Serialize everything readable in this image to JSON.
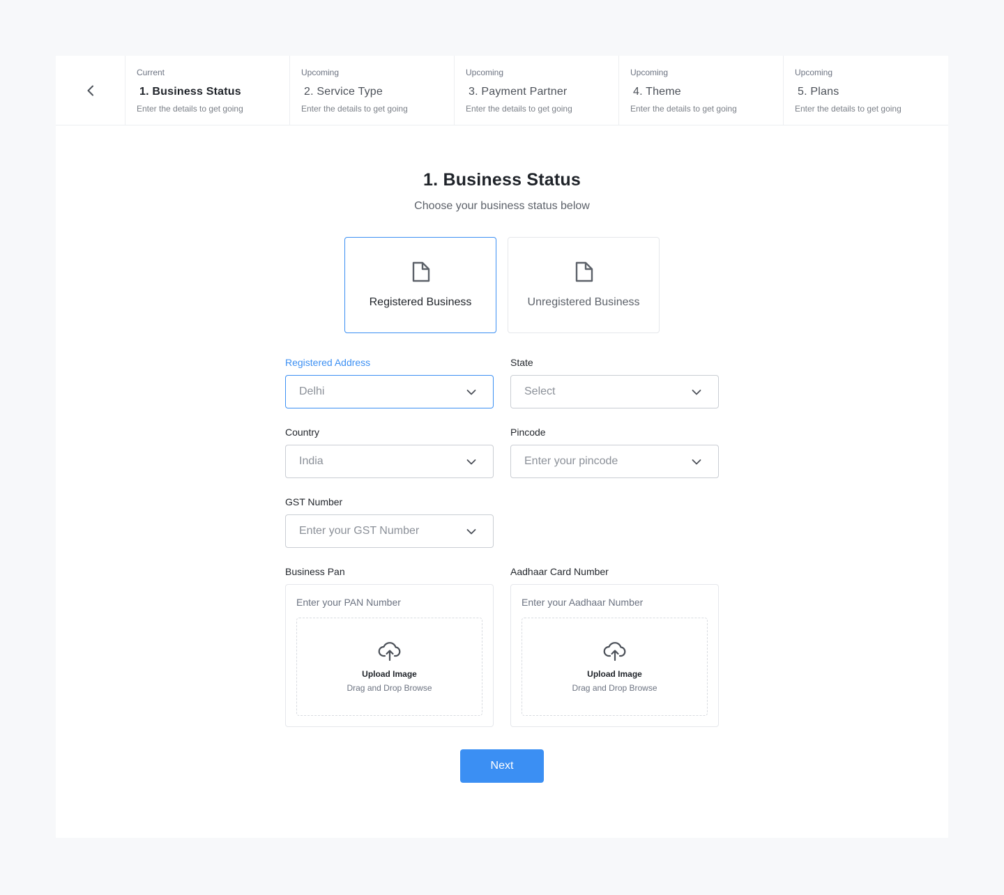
{
  "stepper": {
    "back_icon": "chevron-left-icon",
    "steps": [
      {
        "status": "Current",
        "name": "1. Business Status",
        "desc": "Enter the details to get going"
      },
      {
        "status": "Upcoming",
        "name": "2. Service Type",
        "desc": "Enter the details to get going"
      },
      {
        "status": "Upcoming",
        "name": "3. Payment Partner",
        "desc": "Enter the details to get going"
      },
      {
        "status": "Upcoming",
        "name": "4. Theme",
        "desc": "Enter the details to get going"
      },
      {
        "status": "Upcoming",
        "name": "5. Plans",
        "desc": "Enter the details to get going"
      }
    ]
  },
  "main": {
    "title": "1. Business Status",
    "subtitle": "Choose your business status below"
  },
  "options": [
    {
      "label": "Registered Business",
      "icon": "document-icon",
      "selected": true
    },
    {
      "label": "Unregistered Business",
      "icon": "document-icon",
      "selected": false
    }
  ],
  "form": {
    "registered_address": {
      "label": "Registered Address",
      "value": "Delhi"
    },
    "state": {
      "label": "State",
      "value": "Select"
    },
    "country": {
      "label": "Country",
      "value": "India"
    },
    "pincode": {
      "label": "Pincode",
      "value": "Enter your pincode"
    },
    "gst": {
      "label": "GST Number",
      "value": "Enter your GST Number"
    },
    "business_pan": {
      "label": "Business Pan",
      "placeholder": "Enter your PAN Number",
      "upload_title": "Upload Image",
      "upload_sub": "Drag and Drop Browse"
    },
    "aadhaar": {
      "label": "Aadhaar Card Number",
      "placeholder": "Enter your Aadhaar Number",
      "upload_title": "Upload Image",
      "upload_sub": "Drag and Drop Browse"
    }
  },
  "actions": {
    "next_label": "Next"
  },
  "colors": {
    "accent": "#3b8ff3",
    "background": "#f7f8fa",
    "border": "#c9cdd3"
  }
}
